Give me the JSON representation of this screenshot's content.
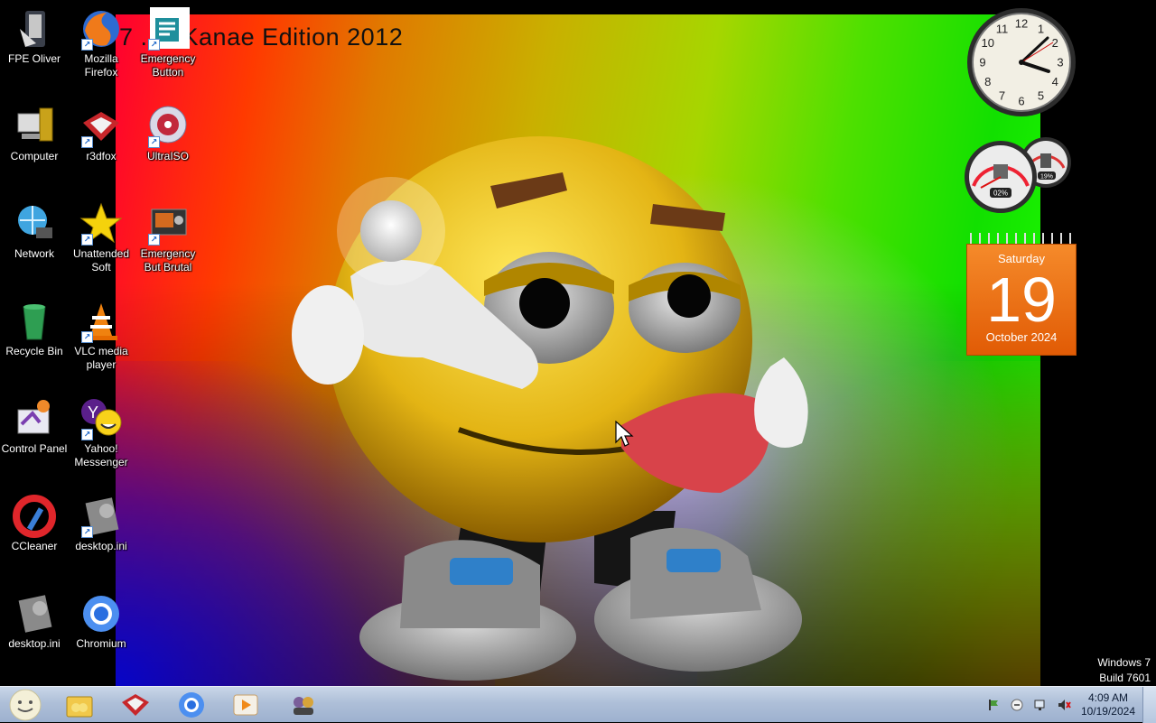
{
  "wallpaper": {
    "title": "7 ... sKanae Edition 2012"
  },
  "desktop_icons": [
    {
      "label": "FPE Oliver"
    },
    {
      "label": "Mozilla Firefox"
    },
    {
      "label": "Emergency Button"
    },
    {
      "label": "Computer"
    },
    {
      "label": "r3dfox"
    },
    {
      "label": "UltraISO"
    },
    {
      "label": "Network"
    },
    {
      "label": "Unattended Soft"
    },
    {
      "label": "Emergency But Brutal"
    },
    {
      "label": "Recycle Bin"
    },
    {
      "label": "VLC media player"
    },
    {
      "label": "Control Panel"
    },
    {
      "label": "Yahoo! Messenger"
    },
    {
      "label": "CCleaner"
    },
    {
      "label": "desktop.ini"
    },
    {
      "label": "desktop.ini"
    },
    {
      "label": "Chromium"
    }
  ],
  "gadgets": {
    "clock": {
      "numerals": [
        "12",
        "1",
        "2",
        "3",
        "4",
        "5",
        "6",
        "7",
        "8",
        "9",
        "10",
        "11"
      ]
    },
    "meter": {
      "cpu": "02%",
      "ram": "19%"
    },
    "calendar": {
      "weekday": "Saturday",
      "day": "19",
      "month_year": "October 2024"
    }
  },
  "os_watermark": {
    "line1": "Windows 7",
    "line2": "Build 7601"
  },
  "taskbar": {
    "time": "4:09 AM",
    "date": "10/19/2024"
  },
  "colors": {
    "taskbar": "#aebfd8",
    "calendar": "#e8670e",
    "smiley": "#e8c21a"
  }
}
